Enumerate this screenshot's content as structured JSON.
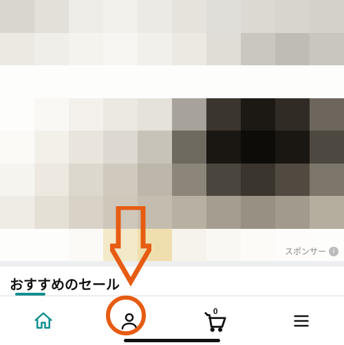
{
  "sponsor_label": "スポンサー",
  "section_title": "おすすめのセール",
  "nav": {
    "home": "home",
    "profile": "profile",
    "cart": "cart",
    "cart_count": "0",
    "menu": "menu"
  },
  "colors": {
    "accent": "#e65c12",
    "teal": "#0f8f8f"
  }
}
